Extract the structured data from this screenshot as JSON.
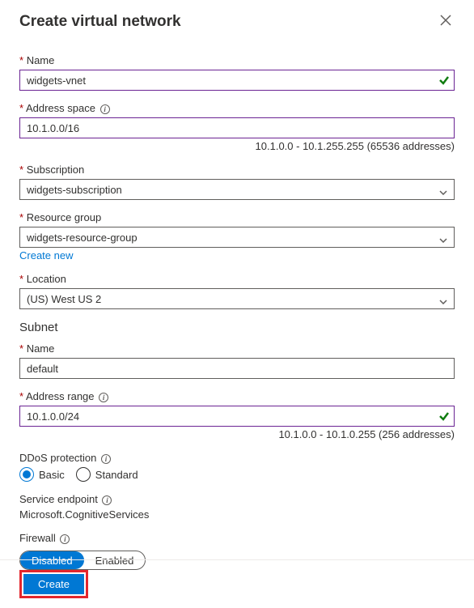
{
  "header": {
    "title": "Create virtual network"
  },
  "fields": {
    "name": {
      "label": "Name",
      "value": "widgets-vnet"
    },
    "addressSpace": {
      "label": "Address space",
      "value": "10.1.0.0/16",
      "hint": "10.1.0.0 - 10.1.255.255 (65536 addresses)"
    },
    "subscription": {
      "label": "Subscription",
      "value": "widgets-subscription"
    },
    "resourceGroup": {
      "label": "Resource group",
      "value": "widgets-resource-group",
      "createNew": "Create new"
    },
    "location": {
      "label": "Location",
      "value": "(US) West US 2"
    }
  },
  "subnet": {
    "title": "Subnet",
    "name": {
      "label": "Name",
      "value": "default"
    },
    "addressRange": {
      "label": "Address range",
      "value": "10.1.0.0/24",
      "hint": "10.1.0.0 - 10.1.0.255 (256 addresses)"
    }
  },
  "ddos": {
    "label": "DDoS protection",
    "options": {
      "basic": "Basic",
      "standard": "Standard"
    }
  },
  "serviceEndpoint": {
    "label": "Service endpoint",
    "value": "Microsoft.CognitiveServices"
  },
  "firewall": {
    "label": "Firewall",
    "options": {
      "disabled": "Disabled",
      "enabled": "Enabled"
    }
  },
  "footer": {
    "create": "Create"
  }
}
